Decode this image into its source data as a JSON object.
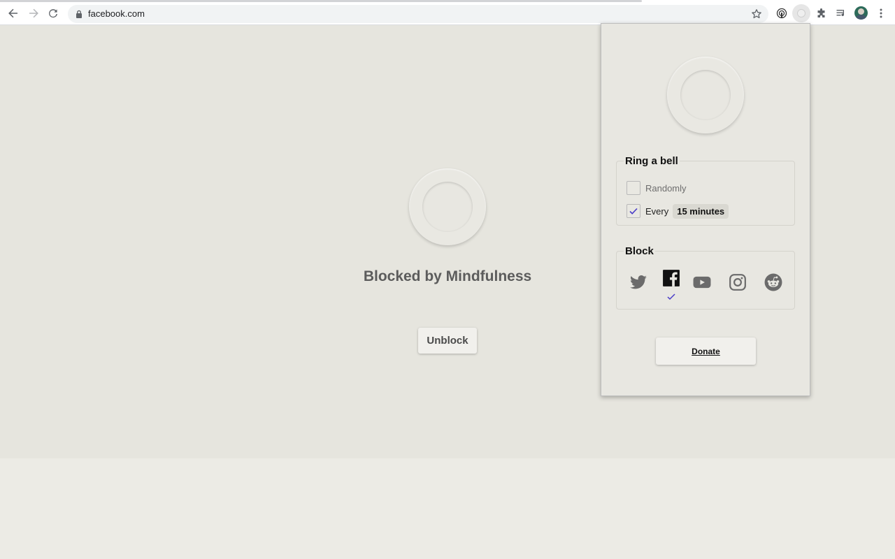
{
  "browser": {
    "url": "facebook.com",
    "nav": {
      "back": "back-arrow-icon",
      "forward": "forward-arrow-icon",
      "reload": "reload-icon"
    },
    "toolbar_icons": [
      "bookmark-star-icon",
      "extension-podcast-icon",
      "mindfulness-extension-icon",
      "puzzle-icon",
      "media-queue-icon",
      "avatar",
      "kebab-menu-icon"
    ]
  },
  "blocked_page": {
    "title": "Blocked by Mindfulness",
    "unblock_label": "Unblock"
  },
  "popup": {
    "bell": {
      "legend": "Ring a bell",
      "randomly_label": "Randomly",
      "randomly_checked": false,
      "every_label": "Every",
      "every_checked": true,
      "interval_value": "15 minutes"
    },
    "block": {
      "legend": "Block",
      "sites": [
        {
          "name": "twitter",
          "checked": false
        },
        {
          "name": "facebook",
          "checked": true
        },
        {
          "name": "youtube",
          "checked": false
        },
        {
          "name": "instagram",
          "checked": false
        },
        {
          "name": "reddit",
          "checked": false
        }
      ]
    },
    "donate_label": "Donate"
  },
  "colors": {
    "page_bg": "#e6e5de",
    "check_accent": "#4a3dc8",
    "icon_gray": "#6b6b6b"
  }
}
